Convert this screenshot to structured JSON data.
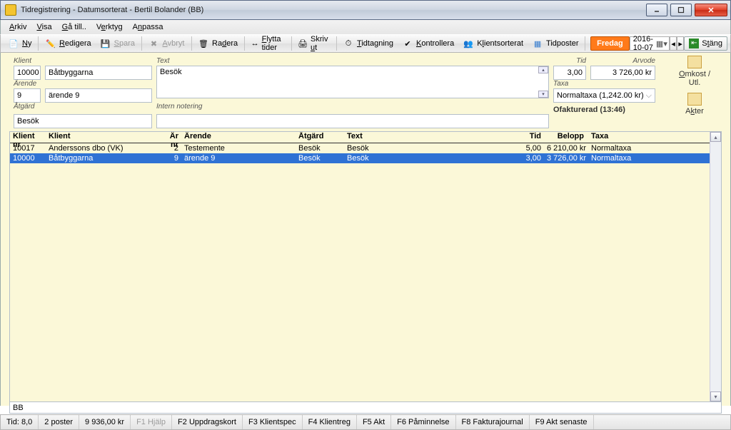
{
  "window": {
    "title": "Tidregistrering - Datumsorterat - Bertil Bolander (BB)"
  },
  "menu": {
    "arkiv": "Arkiv",
    "visa": "Visa",
    "ga": "Gå till..",
    "verktyg": "Verktyg",
    "anpassa": "Anpassa"
  },
  "toolbar": {
    "ny": "Ny",
    "redigera": "Redigera",
    "spara": "Spara",
    "avbryt": "Avbryt",
    "radera": "Radera",
    "flytta": "Flytta tider",
    "skriv": "Skriv ut",
    "tidtag": "Tidtagning",
    "kontroll": "Kontrollera",
    "klients": "Klientsorterat",
    "tidp": "Tidposter",
    "dag": "Fredag",
    "date": "2016-10-07",
    "stang": "Stäng"
  },
  "labels": {
    "klient": "Klient",
    "arende": "Ärende",
    "atgard": "Åtgärd",
    "text": "Text",
    "intern": "Intern notering",
    "tid": "Tid",
    "arvode": "Arvode",
    "taxa": "Taxa"
  },
  "form": {
    "klient_nr": "10000",
    "klient_namn": "Båtbyggarna",
    "arende_nr": "9",
    "arende_namn": "ärende 9",
    "atgard": "Besök",
    "text": "Besök",
    "intern": "",
    "tid": "3,00",
    "arvode": "3 726,00 kr",
    "taxa": "Normaltaxa (1,242.00 kr)",
    "status": "Ofakturerad (13:46)"
  },
  "side": {
    "omkost": "Omkost / Utl.",
    "akter": "Akter"
  },
  "grid": {
    "headers": {
      "nr": "Klient nr",
      "kl": "Klient",
      "ar": "Är nr",
      "ae": "Ärende",
      "at": "Åtgärd",
      "tx": "Text",
      "ti": "Tid",
      "be": "Belopp",
      "ta": "Taxa"
    },
    "rows": [
      {
        "nr": "10017",
        "kl": "Anderssons dbo (VK)",
        "ar": "2",
        "ae": "Testemente",
        "at": "Besök",
        "tx": "Besök",
        "ti": "5,00",
        "be": "6 210,00 kr",
        "ta": "Normaltaxa",
        "sel": false
      },
      {
        "nr": "10000",
        "kl": "Båtbyggarna",
        "ar": "9",
        "ae": "ärende 9",
        "at": "Besök",
        "tx": "Besök",
        "ti": "3,00",
        "be": "3 726,00 kr",
        "ta": "Normaltaxa",
        "sel": true
      }
    ],
    "bb": "BB"
  },
  "statusbar": {
    "tid": "Tid: 8,0",
    "poster": "2 poster",
    "summa": "9 936,00 kr",
    "f1": "F1 Hjälp",
    "f2": "F2 Uppdragskort",
    "f3": "F3 Klientspec",
    "f4": "F4 Klientreg",
    "f5": "F5 Akt",
    "f6": "F6 Påminnelse",
    "f8": "F8 Fakturajournal",
    "f9": "F9 Akt senaste"
  }
}
